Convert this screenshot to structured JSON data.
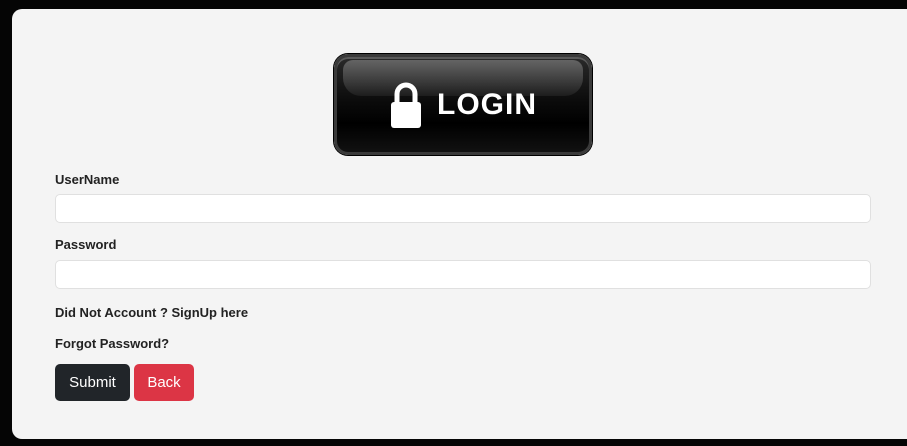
{
  "banner": {
    "text": "LOGIN",
    "icon": "lock-icon"
  },
  "form": {
    "username_label": "UserName",
    "username_value": "",
    "password_label": "Password",
    "password_value": "",
    "signup_link": "Did Not Account ? SignUp here",
    "forgot_link": "Forgot Password?",
    "submit_label": "Submit",
    "back_label": "Back"
  },
  "colors": {
    "submit": "#212529",
    "back": "#dc3545",
    "panel": "#f4f4f4"
  }
}
